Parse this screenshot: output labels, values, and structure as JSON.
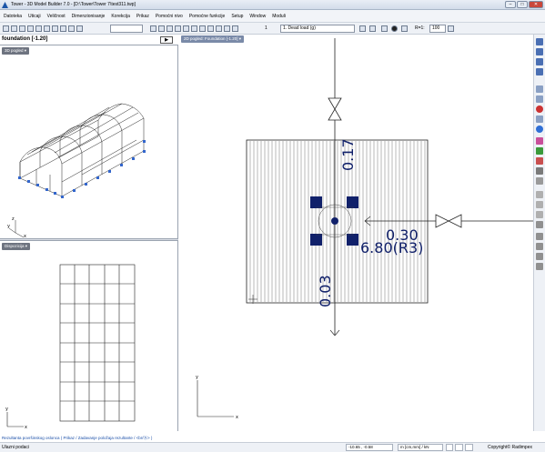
{
  "window": {
    "title": "Tower - 3D Model Builder 7.0 - [D:\\Tower\\Tower 7\\test311.twp]",
    "minimize": "–",
    "maximize": "□",
    "close": "✕"
  },
  "menu": {
    "items": [
      "Datoteka",
      "Uticaji",
      "Veličnost",
      "Dimenzionisanje",
      "Korekcija",
      "Prikaz",
      "Pomoćni nivo",
      "Pomoćne funkcije",
      "Setup",
      "Window",
      "Moduli"
    ]
  },
  "toolbar": {
    "nivo_value": "1",
    "load_case": "1. Dead load (g)",
    "r_label": "R=1:",
    "r_value": "100"
  },
  "left_panel": {
    "title": "foundation   [-1.20]",
    "arrow": "▶",
    "view3d_label": "3D pogled",
    "diagram_label": "Dispozicija",
    "axis_z": "z",
    "axis_y": "y",
    "axis_x": "x"
  },
  "right_panel": {
    "view_label": "2D pogled: Foundation  [-1.20]",
    "value_top": "0.17",
    "value_right": "0.30",
    "value_right_sub": "6.80(R3)",
    "value_bottom": "0.03",
    "axis_y": "y",
    "axis_x": "x"
  },
  "bottom_hint": "Rezultanta površinskog oslonca ( Prikaz / Zadavanje položaja rezultante / <br/Ⓐ> )",
  "status": {
    "left": "Ulazni podaci",
    "coords": "-10.65 , -0.58",
    "units": "m [cm,mm] / kN",
    "copyright": "Copyright© Radimpex"
  }
}
